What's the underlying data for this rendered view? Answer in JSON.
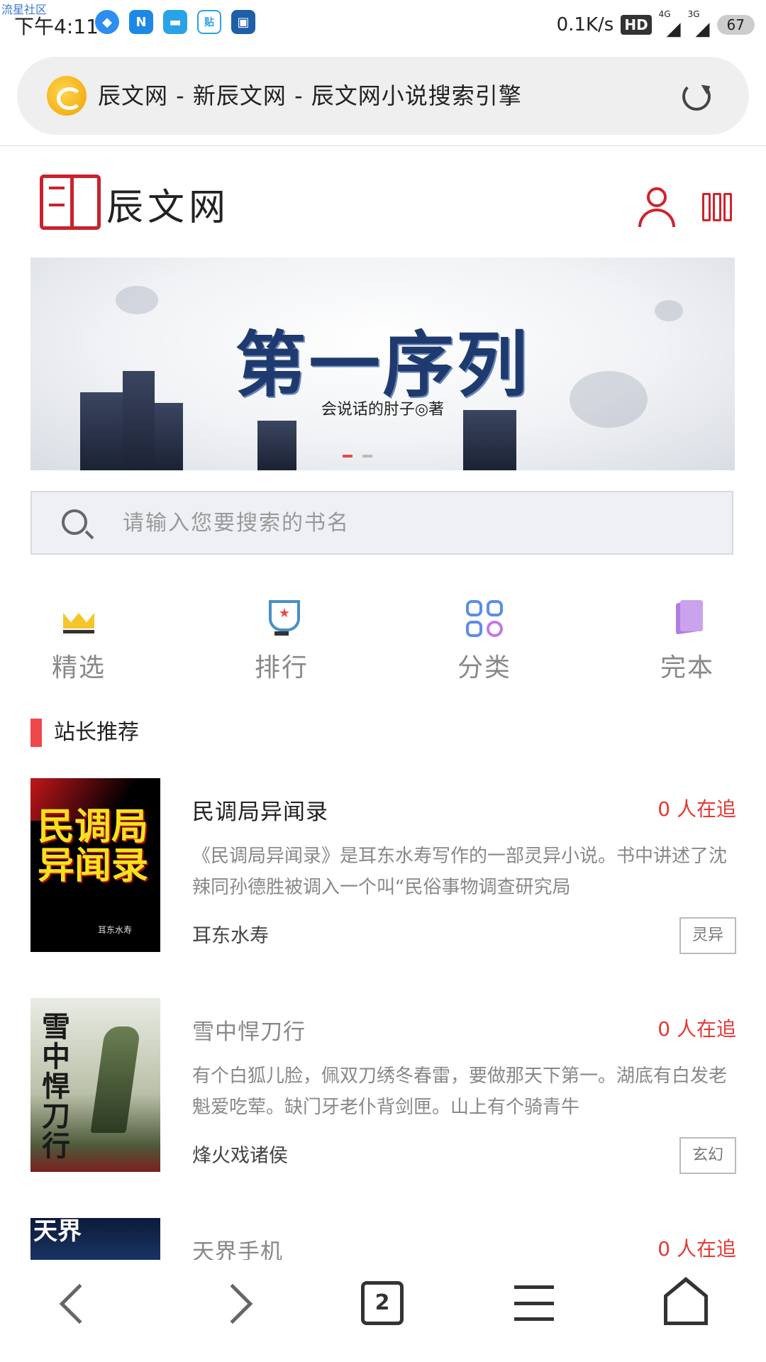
{
  "statusbar": {
    "watermark": "流星社区",
    "time": "下午4:11",
    "net_speed": "0.1K/s",
    "hd": "HD",
    "signal_1": "4G",
    "signal_2": "3G",
    "battery": "67"
  },
  "urlbar": {
    "title": "辰文网 - 新辰文网 - 辰文网小说搜索引擎"
  },
  "site": {
    "logo_text": "辰文网"
  },
  "banner": {
    "title": "第一序列",
    "author": "会说话的肘子◎著"
  },
  "search": {
    "placeholder": "请输入您要搜索的书名"
  },
  "categories": [
    {
      "label": "精选",
      "icon": "crown-icon"
    },
    {
      "label": "排行",
      "icon": "trophy-icon"
    },
    {
      "label": "分类",
      "icon": "grid-icon"
    },
    {
      "label": "完本",
      "icon": "books-icon"
    }
  ],
  "section": {
    "title": "站长推荐"
  },
  "books": [
    {
      "title": "民调局异闻录",
      "followers": "0 人在追",
      "desc": "《民调局异闻录》是耳东水寿写作的一部灵异小说。书中讲述了沈辣同孙德胜被调入一个叫“民俗事物调查研究局",
      "author": "耳东水寿",
      "tag": "灵异",
      "cover_text": "民调局异闻录",
      "cover_sub": "耳东水寿"
    },
    {
      "title": "雪中悍刀行",
      "followers": "0 人在追",
      "desc": "有个白狐儿脸，佩双刀绣冬春雷，要做那天下第一。湖底有白发老魁爱吃荤。缺门牙老仆背剑匣。山上有个骑青牛",
      "author": "烽火戏诸侯",
      "tag": "玄幻",
      "cover_text": "雪中悍刀行"
    },
    {
      "title": "天界手机",
      "followers": "0 人在追",
      "cover_text": "天界"
    }
  ],
  "bottomnav": {
    "tabs_count": "2"
  },
  "colors": {
    "accent": "#e53935",
    "logo_red": "#c8232c",
    "section_bar": "#f0474d"
  }
}
